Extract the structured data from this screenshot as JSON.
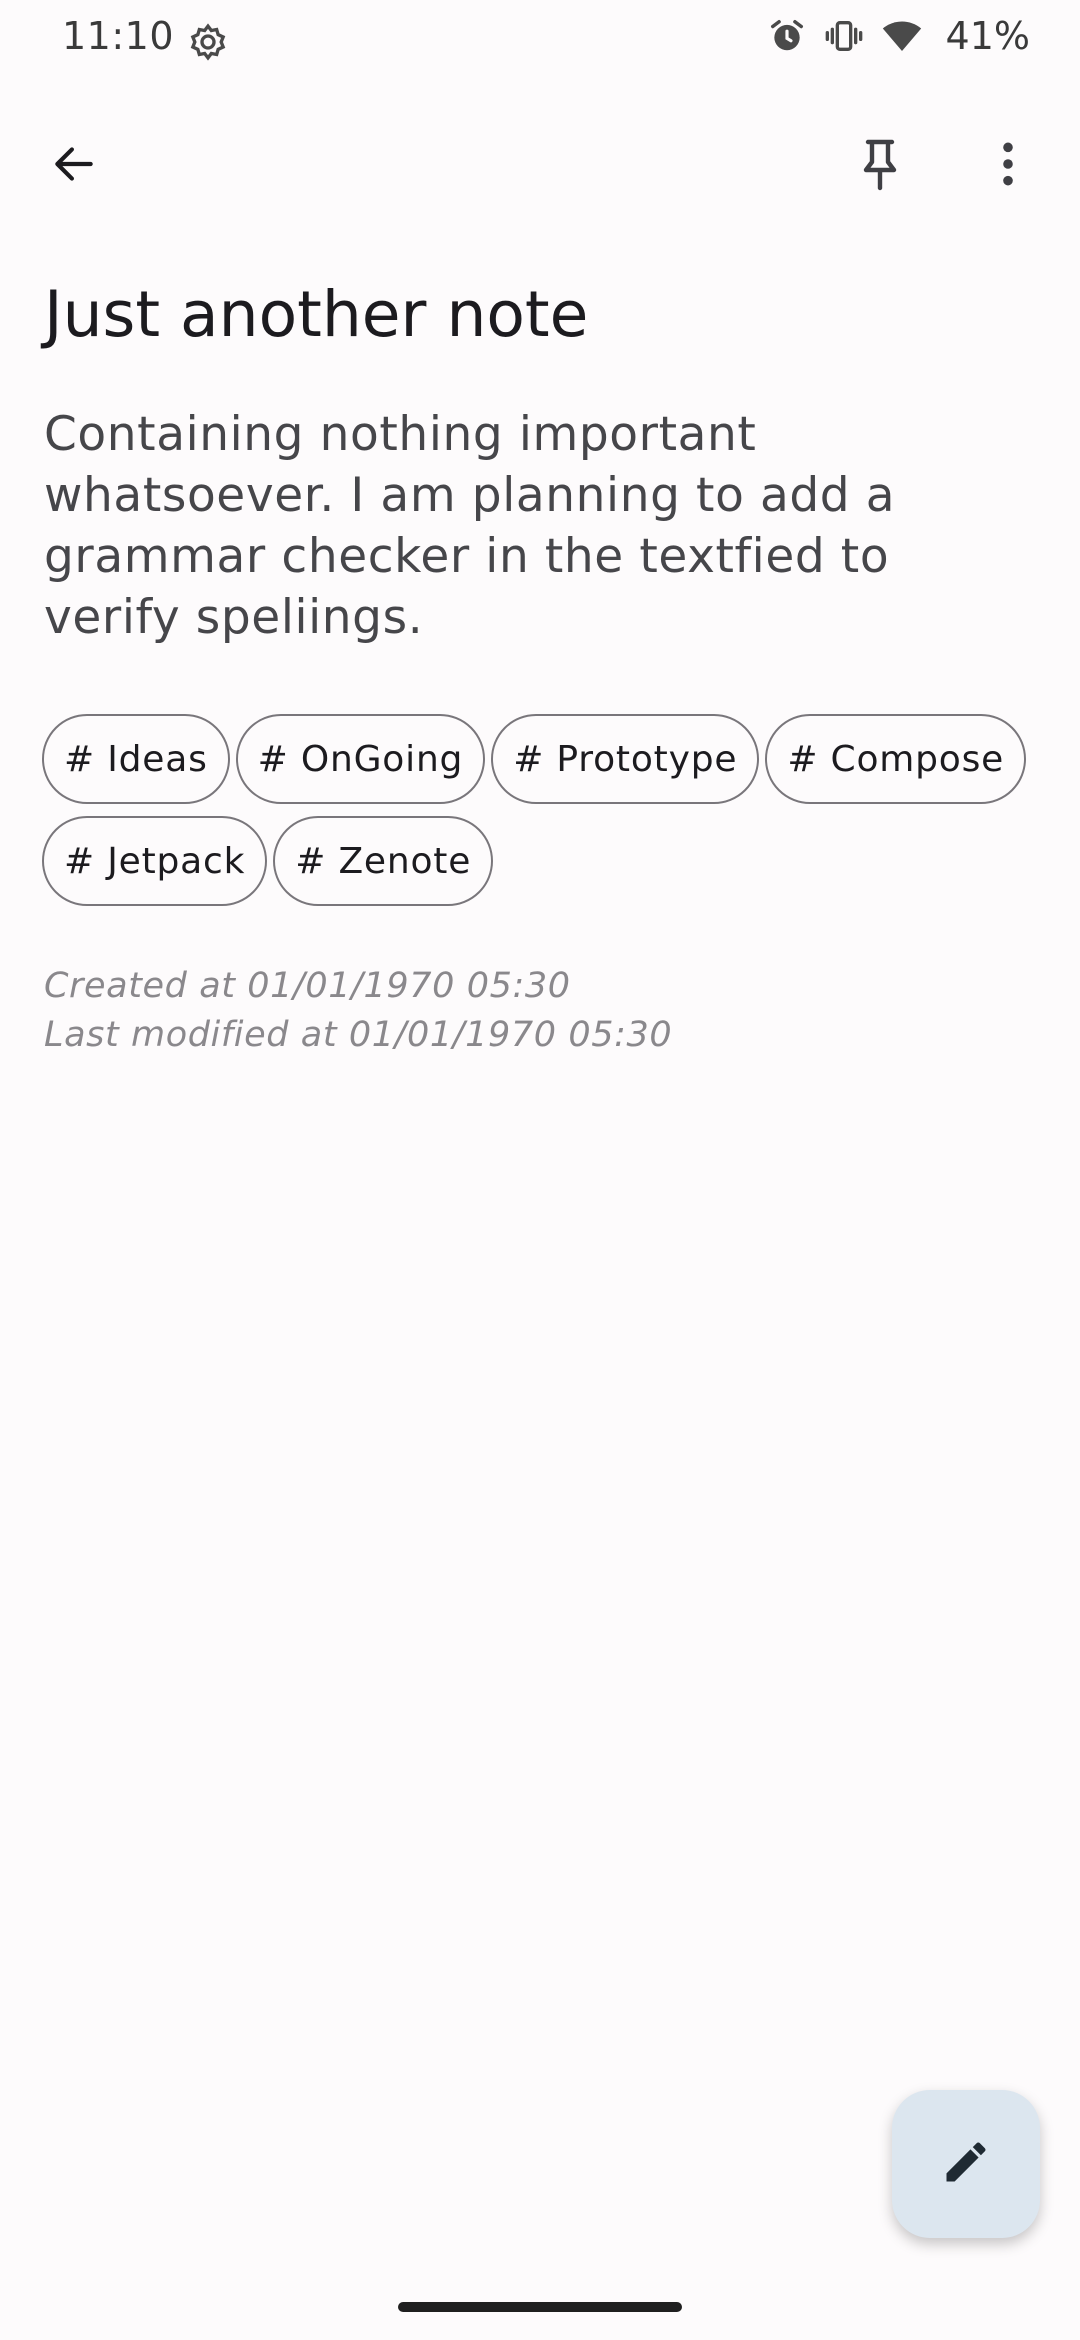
{
  "status_bar": {
    "time": "11:10",
    "battery": "41%",
    "icons": [
      "settings-icon",
      "alarm-icon",
      "vibrate-icon",
      "wifi-icon"
    ]
  },
  "app_bar": {
    "icons": [
      "back-arrow-icon",
      "pin-icon",
      "more-vert-icon"
    ]
  },
  "note": {
    "title": "Just another note",
    "body": "Containing nothing important whatsoever. I am planning to add a grammar checker in the textfied to verify speliings.",
    "tags": [
      {
        "label": "# Ideas"
      },
      {
        "label": "# OnGoing"
      },
      {
        "label": "# Prototype"
      },
      {
        "label": "# Compose"
      },
      {
        "label": "# Jetpack"
      },
      {
        "label": "# Zenote"
      }
    ],
    "created": "Created at 01/01/1970 05:30",
    "modified": "Last modified at 01/01/1970 05:30"
  },
  "fab": {
    "icon": "edit-icon"
  },
  "colors": {
    "background": "#fdfbfc",
    "fab_background": "#dce6ef",
    "tag_border": "#79767b",
    "meta_text": "#8a888c"
  }
}
